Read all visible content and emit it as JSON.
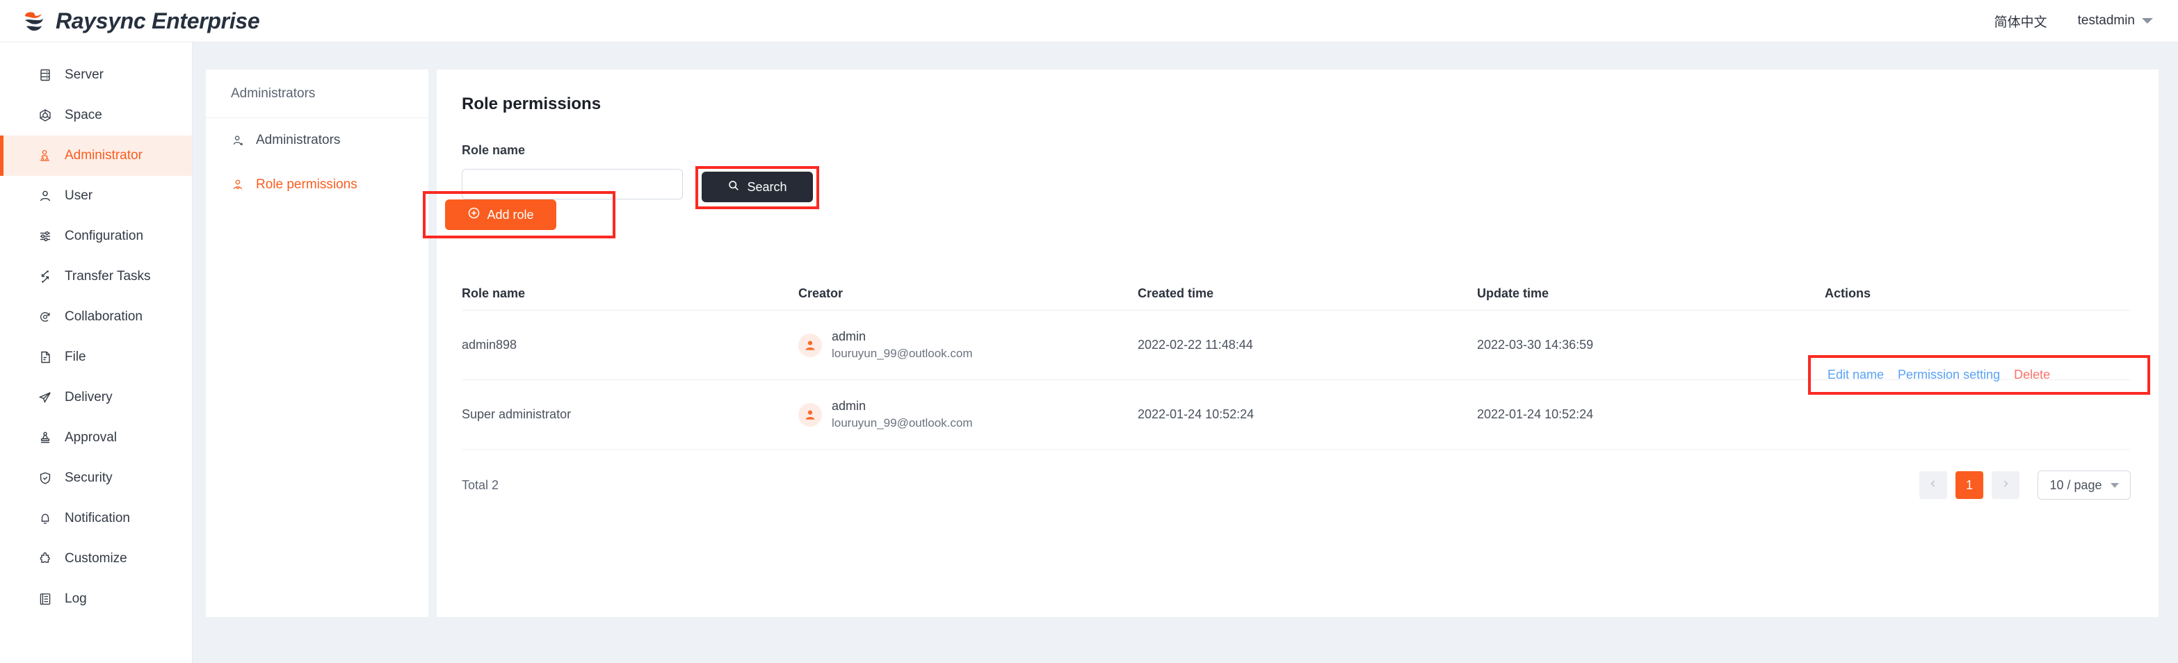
{
  "header": {
    "brand": "Raysync Enterprise",
    "logo_icon": "raysync-logo-icon",
    "language": "简体中文",
    "user": "testadmin",
    "caret_icon": "chevron-down-icon",
    "brand_orange": "#fa5d1f",
    "brand_dark": "#26303f"
  },
  "sidebar": {
    "items": [
      {
        "label": "Server",
        "icon": "server-icon",
        "active": false
      },
      {
        "label": "Space",
        "icon": "space-icon",
        "active": false
      },
      {
        "label": "Administrator",
        "icon": "administrator-icon",
        "active": true
      },
      {
        "label": "User",
        "icon": "user-icon",
        "active": false
      },
      {
        "label": "Configuration",
        "icon": "sliders-icon",
        "active": false
      },
      {
        "label": "Transfer Tasks",
        "icon": "transfer-icon",
        "active": false
      },
      {
        "label": "Collaboration",
        "icon": "collaboration-icon",
        "active": false
      },
      {
        "label": "File",
        "icon": "file-icon",
        "active": false
      },
      {
        "label": "Delivery",
        "icon": "send-icon",
        "active": false
      },
      {
        "label": "Approval",
        "icon": "stamp-icon",
        "active": false
      },
      {
        "label": "Security",
        "icon": "shield-check-icon",
        "active": false
      },
      {
        "label": "Notification",
        "icon": "bell-icon",
        "active": false
      },
      {
        "label": "Customize",
        "icon": "puzzle-icon",
        "active": false
      },
      {
        "label": "Log",
        "icon": "log-icon",
        "active": false
      }
    ],
    "active_accent": "#fa5d1f",
    "active_background": "#fdeee8"
  },
  "subpanel": {
    "title": "Administrators",
    "items": [
      {
        "label": "Administrators",
        "icon": "user-star-icon",
        "active": false
      },
      {
        "label": "Role permissions",
        "icon": "user-check-icon",
        "active": true
      }
    ]
  },
  "main": {
    "page_title": "Role permissions",
    "search": {
      "field_label": "Role name",
      "input_value": "",
      "input_placeholder": "",
      "search_label": "Search",
      "search_icon": "search-icon"
    },
    "add_role": {
      "label": "Add role",
      "icon": "plus-circle-icon"
    },
    "table": {
      "columns": [
        "Role name",
        "Creator",
        "Created time",
        "Update time",
        "Actions"
      ],
      "rows": [
        {
          "role_name": "admin898",
          "creator_name": "admin",
          "creator_email": "louruyun_99@outlook.com",
          "creator_avatar_icon": "user-avatar-icon",
          "created_time": "2022-02-22 11:48:44",
          "update_time": "2022-03-30 14:36:59",
          "actions": [
            {
              "label": "Edit name",
              "style": "link"
            },
            {
              "label": "Permission setting",
              "style": "link"
            },
            {
              "label": "Delete",
              "style": "danger"
            }
          ],
          "actions_highlighted": true
        },
        {
          "role_name": "Super administrator",
          "creator_name": "admin",
          "creator_email": "louruyun_99@outlook.com",
          "creator_avatar_icon": "user-avatar-icon",
          "created_time": "2022-01-24 10:52:24",
          "update_time": "2022-01-24 10:52:24",
          "actions": [],
          "actions_highlighted": false
        }
      ]
    },
    "footer": {
      "total": "Total 2",
      "prev_icon": "chevron-left-icon",
      "next_icon": "chevron-right-icon",
      "current_page": "1",
      "page_size": "10 / page",
      "page_size_icon": "chevron-down-icon"
    }
  },
  "annotations": {
    "color": "#fa2a22",
    "boxes": [
      "search-button",
      "add-role-button",
      "row-actions"
    ]
  }
}
